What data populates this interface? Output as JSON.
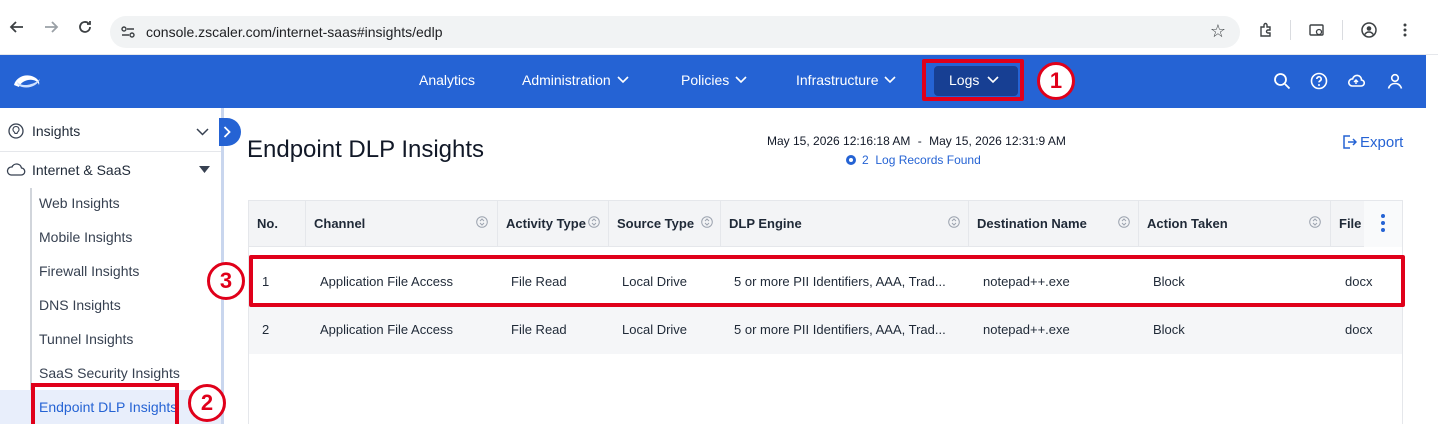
{
  "browser": {
    "url": "console.zscaler.com/internet-saas#insights/edlp"
  },
  "topnav": {
    "items": [
      {
        "label": "Analytics",
        "dropdown": false
      },
      {
        "label": "Administration",
        "dropdown": true
      },
      {
        "label": "Policies",
        "dropdown": true
      },
      {
        "label": "Infrastructure",
        "dropdown": true
      }
    ],
    "logs_label": "Logs",
    "accent": "#2563d4",
    "active_bg": "#173f93"
  },
  "badges": {
    "one": "1",
    "two": "2",
    "three": "3"
  },
  "sidebar": {
    "insights_label": "Insights",
    "section_label": "Internet & SaaS",
    "items": [
      "Web Insights",
      "Mobile Insights",
      "Firewall Insights",
      "DNS Insights",
      "Tunnel Insights",
      "SaaS Security Insights",
      "Endpoint DLP Insights"
    ],
    "active_index": 6
  },
  "main": {
    "title": "Endpoint DLP Insights",
    "range_start": "May 15, 2026 12:16:18 AM",
    "range_sep": "-",
    "range_end": "May 15, 2026 12:31:9 AM",
    "records_count": "2",
    "records_label": "Log Records Found",
    "export_label": "Export"
  },
  "table": {
    "columns": [
      "No.",
      "Channel",
      "Activity Type",
      "Source Type",
      "DLP Engine",
      "Destination Name",
      "Action Taken",
      "File T"
    ],
    "rows": [
      [
        "1",
        "Application File Access",
        "File Read",
        "Local Drive",
        "5 or more PII Identifiers, AAA, Trad...",
        "notepad++.exe",
        "Block",
        "docx"
      ],
      [
        "2",
        "Application File Access",
        "File Read",
        "Local Drive",
        "5 or more PII Identifiers, AAA, Trad...",
        "notepad++.exe",
        "Block",
        "docx"
      ]
    ]
  },
  "highlight_color": "#e0001a"
}
